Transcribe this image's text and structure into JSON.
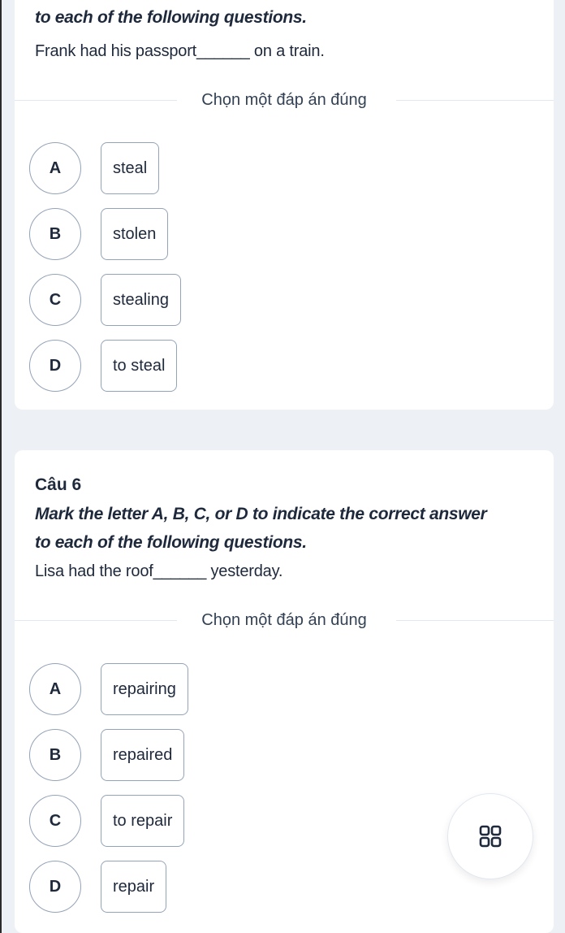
{
  "question5": {
    "instruction_tail": "to each of the following questions.",
    "sentence": "Frank had his passport______ on a train.",
    "prompt": "Chọn một đáp án đúng",
    "options": [
      {
        "letter": "A",
        "text": "steal"
      },
      {
        "letter": "B",
        "text": "stolen"
      },
      {
        "letter": "C",
        "text": "stealing"
      },
      {
        "letter": "D",
        "text": "to steal"
      }
    ]
  },
  "question6": {
    "title": "Câu 6",
    "instruction_line1": "Mark the letter A, B, C, or D to indicate the correct answer",
    "instruction_line2": "to each of the following questions.",
    "sentence": "Lisa had the roof______ yesterday.",
    "prompt": "Chọn một đáp án đúng",
    "options": [
      {
        "letter": "A",
        "text": "repairing"
      },
      {
        "letter": "B",
        "text": "repaired"
      },
      {
        "letter": "C",
        "text": "to repair"
      },
      {
        "letter": "D",
        "text": "repair"
      }
    ]
  },
  "fab": {
    "icon": "grid-icon"
  }
}
